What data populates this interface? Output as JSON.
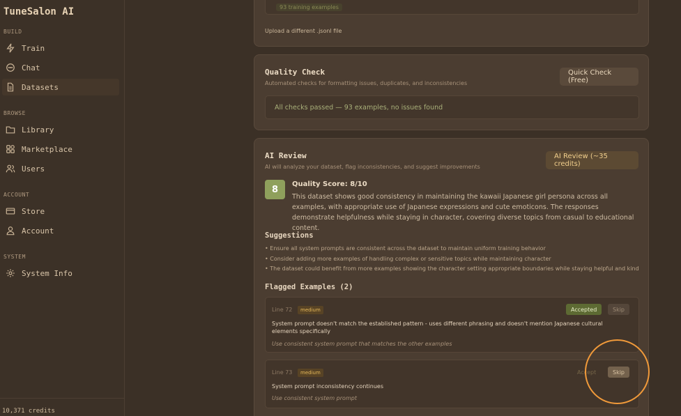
{
  "app": {
    "title": "TuneSalon AI",
    "credits": "10,371 credits"
  },
  "sidebar": {
    "sections": {
      "build": "BUILD",
      "browse": "BROWSE",
      "account": "ACCOUNT",
      "system": "SYSTEM"
    },
    "items": [
      {
        "label": "Train",
        "icon": "bolt-icon"
      },
      {
        "label": "Chat",
        "icon": "chat-icon"
      },
      {
        "label": "Datasets",
        "icon": "document-icon",
        "active": true
      },
      {
        "label": "Library",
        "icon": "folder-icon"
      },
      {
        "label": "Marketplace",
        "icon": "grid-icon"
      },
      {
        "label": "Users",
        "icon": "users-icon"
      },
      {
        "label": "Store",
        "icon": "card-icon"
      },
      {
        "label": "Account",
        "icon": "person-icon"
      },
      {
        "label": "System Info",
        "icon": "gear-icon"
      }
    ]
  },
  "upload": {
    "examples_badge": "93 training examples",
    "change_link": "Upload a different .jsonl file"
  },
  "quality": {
    "title": "Quality Check",
    "subtitle": "Automated checks for formatting issues, duplicates, and inconsistencies",
    "button": "Quick Check (Free)",
    "result": "All checks passed — 93 examples, no issues found"
  },
  "review": {
    "title": "AI Review",
    "subtitle": "AI will analyze your dataset, flag inconsistencies, and suggest improvements",
    "button": "AI Review (~35 credits)",
    "score": "8",
    "score_title": "Quality Score: 8/10",
    "score_text": "This dataset shows good consistency in maintaining the kawaii Japanese girl persona across all examples, with appropriate use of Japanese expressions and cute emoticons. The responses demonstrate helpfulness while staying in character, covering diverse topics from casual to educational content.",
    "suggestions_title": "Suggestions",
    "suggestions": [
      "• Ensure all system prompts are consistent across the dataset to maintain uniform training behavior",
      "• Consider adding more examples of handling complex or sensitive topics while maintaining character",
      "• The dataset could benefit from more examples showing the character setting appropriate boundaries while staying helpful and kind"
    ],
    "flagged_title": "Flagged Examples (2)",
    "flagged": [
      {
        "line": "Line 72",
        "severity": "medium",
        "message": "System prompt doesn't match the established pattern - uses different phrasing and doesn't mention Japanese cultural elements specifically",
        "fix": "Use consistent system prompt that matches the other examples",
        "accept_label": "Accepted",
        "skip_label": "Skip"
      },
      {
        "line": "Line 73",
        "severity": "medium",
        "message": "System prompt inconsistency continues",
        "fix": "Use consistent system prompt",
        "accept_label": "Accept",
        "skip_label": "Skip"
      }
    ]
  },
  "colors": {
    "accent": "#f19a3a",
    "score": "#8fa05c",
    "accepted": "#5d6a33"
  }
}
